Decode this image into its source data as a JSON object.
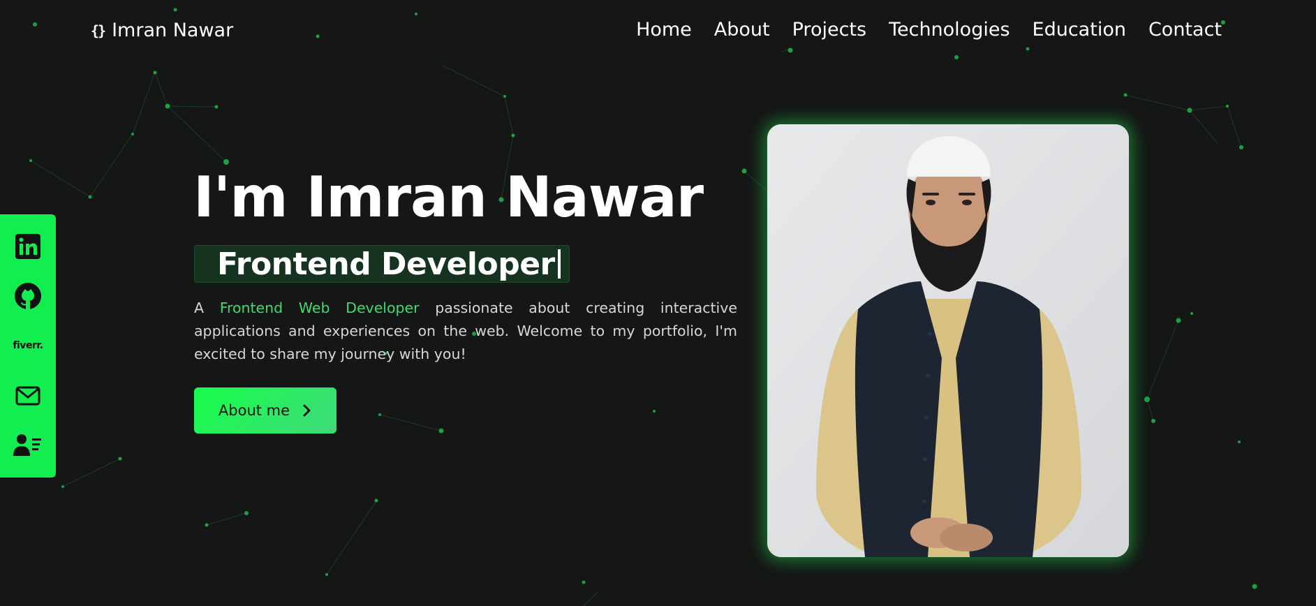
{
  "header": {
    "brand_icon": "{}",
    "brand_name": "Imran Nawar",
    "nav": [
      "Home",
      "About",
      "Projects",
      "Technologies",
      "Education",
      "Contact"
    ]
  },
  "social": [
    {
      "icon": "linkedin-icon"
    },
    {
      "icon": "github-icon"
    },
    {
      "icon": "fiverr-icon",
      "label": "fiverr."
    },
    {
      "icon": "mail-icon"
    },
    {
      "icon": "contact-card-icon"
    }
  ],
  "hero": {
    "title": "I'm Imran Nawar",
    "role": "Frontend Developer",
    "intro_prefix": "A ",
    "intro_accent": "Frontend Web Developer",
    "intro_suffix": " passionate about creating interactive applications and experiences on the web. Welcome to my portfolio, I'm excited to share my journey with you!",
    "button_label": "About me",
    "button_icon": "chevron-right-icon"
  },
  "colors": {
    "background": "#151716",
    "accent": "#12ed4f",
    "accent_text": "#3ddc72",
    "role_box": "#163320"
  }
}
